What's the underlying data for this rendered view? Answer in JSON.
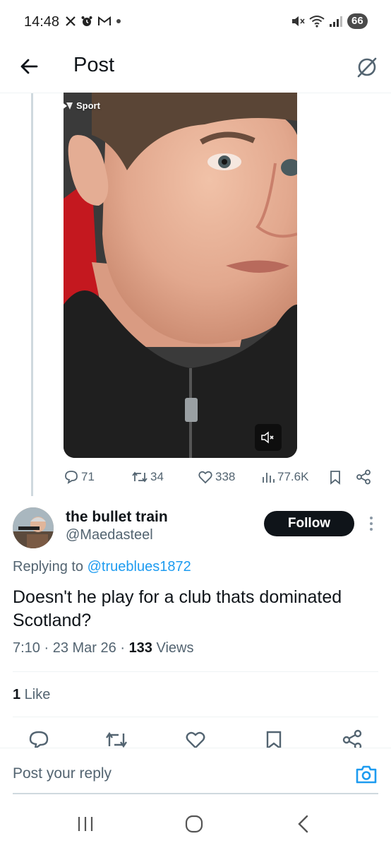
{
  "status_bar": {
    "time": "14:48",
    "battery": "66",
    "icons_left": [
      "x-logo-icon",
      "alarm-icon",
      "gmail-icon",
      "dot-icon"
    ],
    "icons_right": [
      "mute-icon",
      "wifi-icon",
      "signal-icon"
    ]
  },
  "header": {
    "title": "Post",
    "back_icon": "arrow-left-icon",
    "grok_icon": "grok-icon"
  },
  "quoted_post": {
    "video_badge": "Sport",
    "stats": {
      "replies": "71",
      "reposts": "34",
      "likes": "338",
      "views": "77.6K"
    }
  },
  "reply": {
    "display_name": "the bullet train",
    "handle": "@Maedasteel",
    "follow_label": "Follow",
    "replying_prefix": "Replying to ",
    "replying_to": "@trueblues1872",
    "text": "Doesn't he play for a club thats dominated Scotland?",
    "time": "7:10",
    "date": "23 Mar 26",
    "views_count": "133",
    "views_label": " Views",
    "likes_count": "1",
    "likes_label": " Like",
    "separator": " · "
  },
  "composer": {
    "placeholder": "Post your reply"
  },
  "colors": {
    "accent": "#1d9bf0",
    "text": "#0f1419",
    "secondary": "#536471",
    "divider": "#eff3f4"
  }
}
